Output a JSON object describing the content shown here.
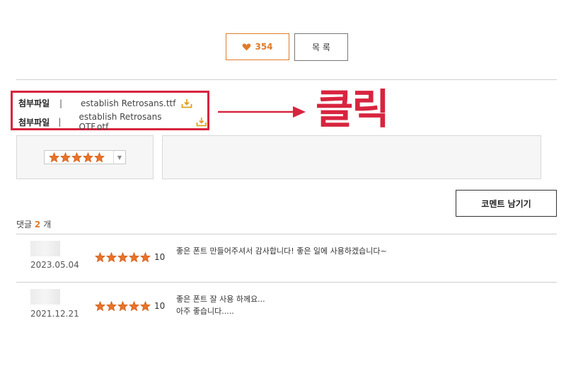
{
  "actions": {
    "like_count": "354",
    "list_label": "목 록"
  },
  "attachments": {
    "items": [
      {
        "label": "첨부파일",
        "separator": "|",
        "filename": "establish Retrosans.ttf"
      },
      {
        "label": "첨부파일",
        "separator": "|",
        "filename": "establish Retrosans OTF.otf"
      }
    ],
    "annotation": "클릭"
  },
  "rating_input": {
    "selected_stars": 5
  },
  "comments": {
    "write_button": "코멘트 남기기",
    "count_prefix": "댓글",
    "count": "2",
    "count_suffix": "개",
    "items": [
      {
        "date": "2023.05.04",
        "rating": "10",
        "text": [
          "좋은 폰트 만들어주셔서 감사합니다! 좋은 일에 사용하겠습니다~"
        ]
      },
      {
        "date": "2021.12.21",
        "rating": "10",
        "text": [
          "좋은 폰트 잘 사용 하께요...",
          "아주 좋습니다....."
        ]
      }
    ]
  },
  "colors": {
    "accent": "#e07b2a",
    "highlight": "#d8243f",
    "star": "#e8732a"
  }
}
